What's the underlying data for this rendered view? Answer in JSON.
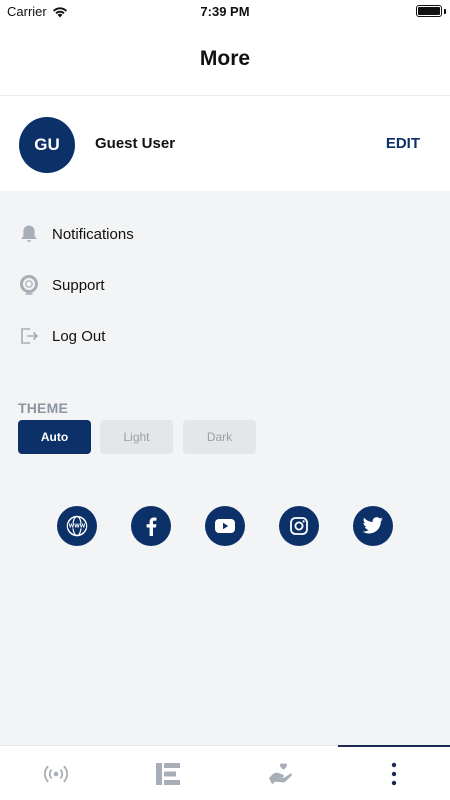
{
  "status_bar": {
    "carrier": "Carrier",
    "time": "7:39 PM"
  },
  "header": {
    "title": "More"
  },
  "profile": {
    "initials": "GU",
    "name": "Guest User",
    "edit_label": "EDIT"
  },
  "menu": {
    "items": [
      {
        "label": "Notifications",
        "icon": "bell-icon"
      },
      {
        "label": "Support",
        "icon": "lifebuoy-icon"
      },
      {
        "label": "Log Out",
        "icon": "logout-icon"
      }
    ]
  },
  "theme": {
    "heading": "THEME",
    "options": [
      "Auto",
      "Light",
      "Dark"
    ],
    "selected": "Auto"
  },
  "social": [
    "website-icon",
    "facebook-icon",
    "youtube-icon",
    "instagram-icon",
    "twitter-icon"
  ],
  "tab_bar": {
    "tabs": [
      "broadcast-icon",
      "logo-e-icon",
      "hand-heart-icon",
      "more-vertical-icon"
    ],
    "active": "more-vertical-icon"
  },
  "colors": {
    "brand": "#0c3068",
    "background": "#f3f4f5",
    "muted": "#8c95a0"
  }
}
